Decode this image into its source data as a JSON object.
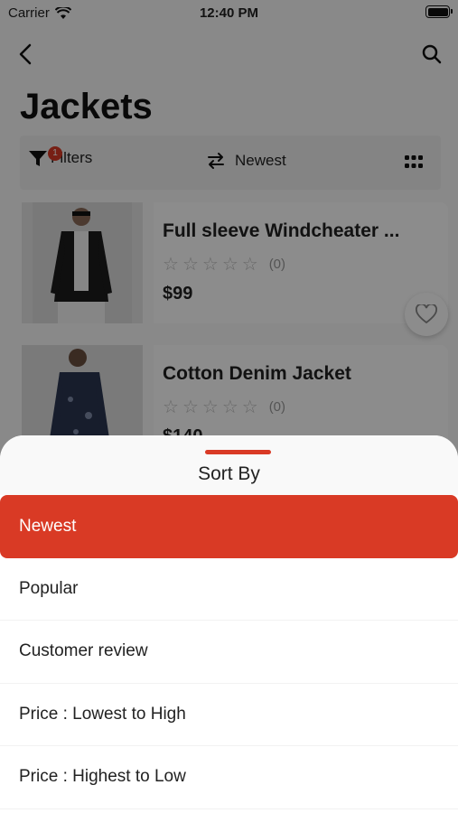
{
  "status_bar": {
    "carrier": "Carrier",
    "time": "12:40 PM"
  },
  "header": {
    "title": "Jackets"
  },
  "filter_bar": {
    "filters_label": "Filters",
    "filters_badge": "1",
    "sort_label": "Newest"
  },
  "products": [
    {
      "name": "Full sleeve Windcheater ...",
      "rating_count": "(0)",
      "price": "$99"
    },
    {
      "name": "Cotton Denim Jacket",
      "rating_count": "(0)",
      "price": "$140"
    }
  ],
  "sort_sheet": {
    "title": "Sort By",
    "options": [
      "Newest",
      "Popular",
      "Customer review",
      "Price : Lowest to High",
      "Price : Highest to Low"
    ],
    "selected": "Newest"
  },
  "colors": {
    "accent": "#d93a25",
    "background": "#f9f9f9"
  }
}
